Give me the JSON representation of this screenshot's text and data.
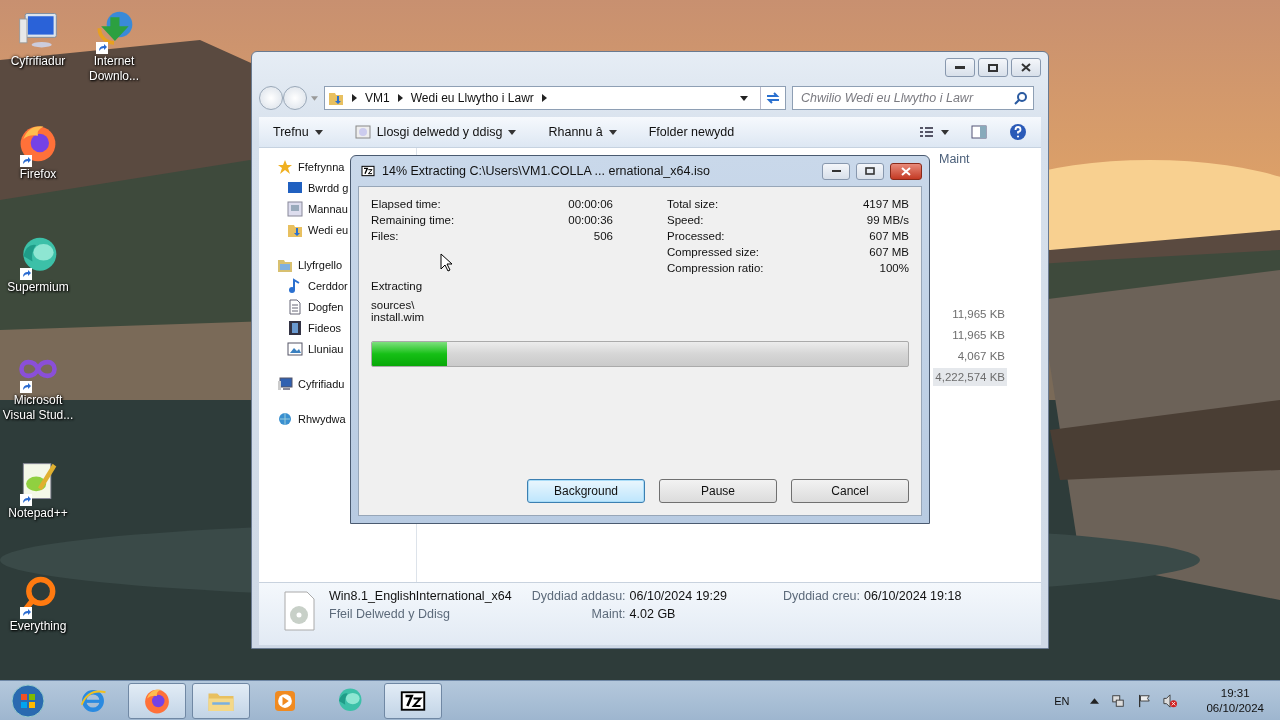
{
  "desktop_icons": [
    {
      "label": "Cyfrifiadur",
      "kind": "computer",
      "shortcut": false
    },
    {
      "label": "Internet Downlo...",
      "kind": "downloader",
      "shortcut": true
    },
    {
      "label": "Firefox",
      "kind": "firefox",
      "shortcut": true
    },
    {
      "label": "Supermium",
      "kind": "supermium",
      "shortcut": true
    },
    {
      "label": "Microsoft Visual Stud...",
      "kind": "infinity",
      "shortcut": true
    },
    {
      "label": "Notepad++",
      "kind": "notepad",
      "shortcut": true
    },
    {
      "label": "Everything",
      "kind": "ring",
      "shortcut": true
    }
  ],
  "explorer": {
    "address": [
      "VM1",
      "Wedi eu Llwytho i Lawr"
    ],
    "search": {
      "placeholder": "Chwilio Wedi eu Llwytho i Lawr"
    },
    "toolbar": [
      {
        "label": "Trefnu",
        "kind": "menu"
      },
      {
        "label": "Llosgi delwedd y ddisg",
        "kind": "burn"
      },
      {
        "label": "Rhannu â",
        "kind": "menu"
      },
      {
        "label": "Ffolder newydd",
        "kind": "plain"
      }
    ],
    "sidebar": [
      {
        "label": "Ffefrynna",
        "kind": "star",
        "children": [
          {
            "label": "Bwrdd g",
            "kind": "desktop"
          },
          {
            "label": "Mannau",
            "kind": "places"
          },
          {
            "label": "Wedi eu",
            "kind": "downloads"
          }
        ]
      },
      {
        "label": "Llyfrgello",
        "kind": "library",
        "children": [
          {
            "label": "Cerddor",
            "kind": "music"
          },
          {
            "label": "Dogfen",
            "kind": "document"
          },
          {
            "label": "Fideos",
            "kind": "video"
          },
          {
            "label": "Lluniau",
            "kind": "pictures"
          }
        ]
      },
      {
        "label": "Cyfrifiadu",
        "kind": "computer"
      },
      {
        "label": "Rhwydwa",
        "kind": "network"
      }
    ],
    "columns": [
      "Maint"
    ],
    "rows": [
      {
        "size": "11,965 KB",
        "selected": false
      },
      {
        "size": "11,965 KB",
        "selected": false
      },
      {
        "size": "4,067 KB",
        "selected": false
      },
      {
        "size": "4,222,574 KB",
        "selected": true
      }
    ],
    "details": {
      "name": "Win8.1_EnglishInternational_x64",
      "type": "Ffeil Delwedd y Ddisg",
      "fields": [
        {
          "label": "Dyddiad addasu:",
          "value": "06/10/2024 19:29"
        },
        {
          "label": "Dyddiad creu:",
          "value": "06/10/2024 19:18"
        },
        {
          "label": "Maint:",
          "value": "4.02 GB"
        }
      ]
    }
  },
  "dialog": {
    "title": "14% Extracting C:\\Users\\VM1.COLLA ... ernational_x64.iso",
    "stats_left": [
      {
        "label": "Elapsed time:",
        "value": "00:00:06"
      },
      {
        "label": "Remaining time:",
        "value": "00:00:36"
      },
      {
        "label": "Files:",
        "value": "506"
      }
    ],
    "stats_right": [
      {
        "label": "Total size:",
        "value": "4197 MB"
      },
      {
        "label": "Speed:",
        "value": "99 MB/s"
      },
      {
        "label": "Processed:",
        "value": "607 MB"
      },
      {
        "label": "Compressed size:",
        "value": "607 MB"
      },
      {
        "label": "Compression ratio:",
        "value": "100%"
      }
    ],
    "status": "Extracting",
    "path": [
      "sources\\",
      "install.wim"
    ],
    "progress": {
      "level": 0.14
    },
    "buttons": [
      {
        "label": "Background",
        "focused": true
      },
      {
        "label": "Pause",
        "focused": false
      },
      {
        "label": "Cancel",
        "focused": false
      }
    ]
  },
  "taskbar": {
    "items": [
      {
        "kind": "ie",
        "open": false
      },
      {
        "kind": "firefox",
        "open": true
      },
      {
        "kind": "explorer",
        "open": true
      },
      {
        "kind": "media",
        "open": false
      },
      {
        "kind": "supermium",
        "open": false
      },
      {
        "kind": "sevenzip",
        "open": true
      }
    ],
    "language": "EN",
    "time": "19:31",
    "date": "06/10/2024"
  }
}
